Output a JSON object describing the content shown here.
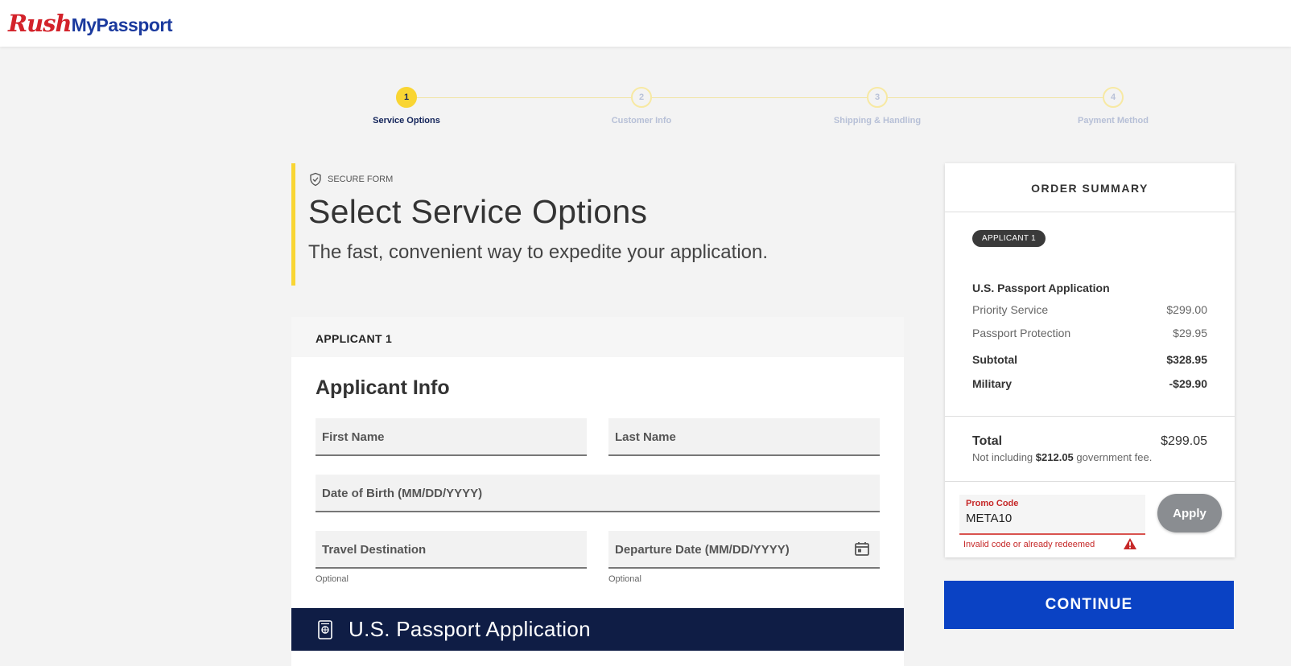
{
  "brand": {
    "logo_part1": "Rush",
    "logo_part2": "MyPassport"
  },
  "stepper": {
    "steps": [
      {
        "number": "1",
        "label": "Service Options",
        "active": true
      },
      {
        "number": "2",
        "label": "Customer Info",
        "active": false
      },
      {
        "number": "3",
        "label": "Shipping & Handling",
        "active": false
      },
      {
        "number": "4",
        "label": "Payment Method",
        "active": false
      }
    ]
  },
  "heading": {
    "secure_label": "SECURE FORM",
    "title": "Select Service Options",
    "subtitle": "The fast, convenient way to expedite your application."
  },
  "applicant_card": {
    "header": "APPLICANT 1",
    "section_title": "Applicant Info",
    "fields": {
      "first_name": "First Name",
      "last_name": "Last Name",
      "dob": "Date of Birth (MM/DD/YYYY)",
      "travel_destination": "Travel Destination",
      "departure_date": "Departure Date (MM/DD/YYYY)"
    },
    "optional_label": "Optional",
    "band_title": "U.S. Passport Application"
  },
  "order_summary": {
    "title": "ORDER SUMMARY",
    "applicant_pill": "APPLICANT 1",
    "product_title": "U.S. Passport Application",
    "items": [
      {
        "label": "Priority Service",
        "value": "$299.00"
      },
      {
        "label": "Passport Protection",
        "value": "$29.95"
      }
    ],
    "subtotal": {
      "label": "Subtotal",
      "value": "$328.95"
    },
    "military": {
      "label": "Military",
      "value": "-$29.90"
    },
    "total": {
      "label": "Total",
      "value": "$299.05"
    },
    "note_prefix": "Not including ",
    "note_amount": "$212.05",
    "note_suffix": " government fee.",
    "promo": {
      "label": "Promo Code",
      "value": "META10",
      "error": "Invalid code or already redeemed",
      "apply_label": "Apply"
    }
  },
  "continue_label": "CONTINUE",
  "colors": {
    "brand_red": "#d3222a",
    "brand_blue": "#1b3a9e",
    "accent_yellow": "#f9d533",
    "navy": "#0f1d45",
    "continue_blue": "#0a42c4",
    "error_red": "#c62828"
  },
  "icons": {
    "secure": "shield-check-icon",
    "calendar": "calendar-icon",
    "passport": "passport-icon",
    "warning": "warning-icon"
  }
}
